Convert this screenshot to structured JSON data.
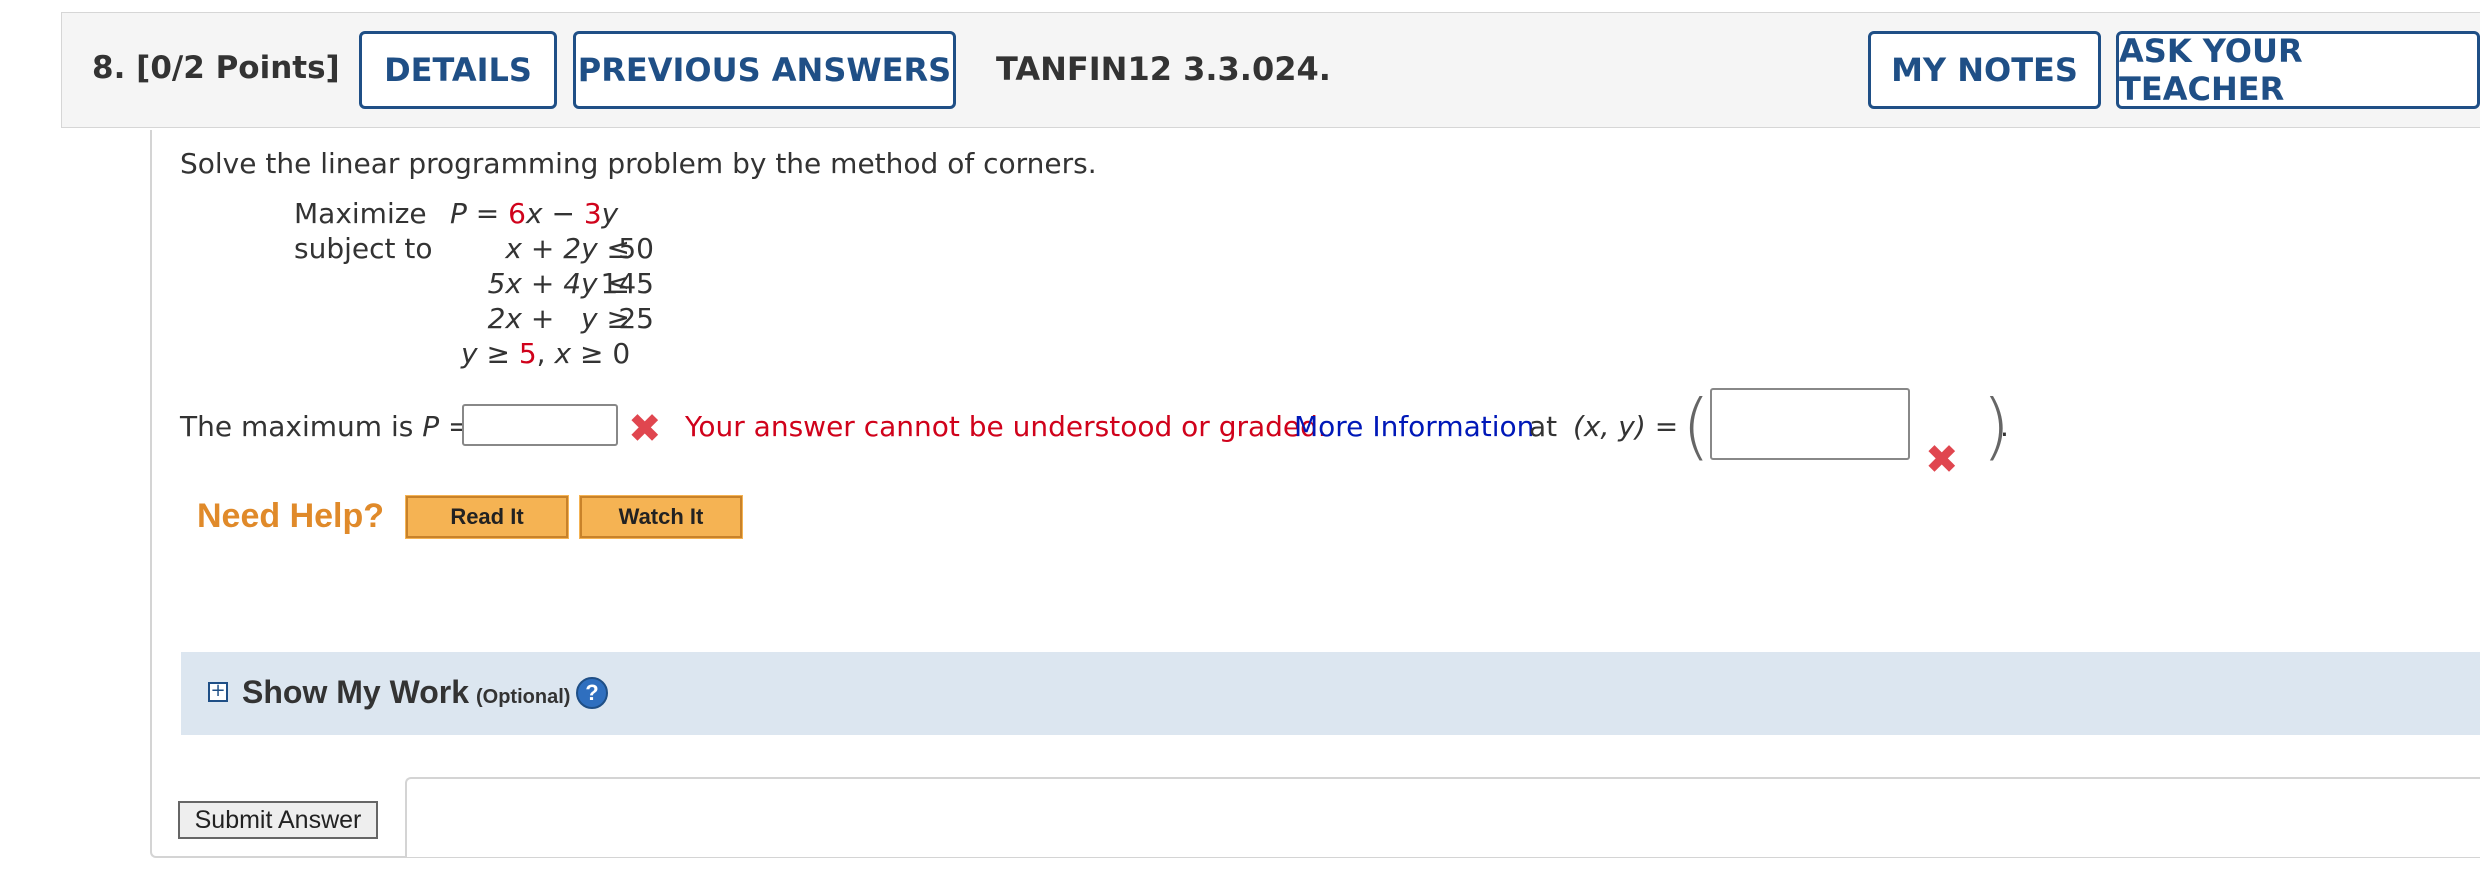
{
  "header": {
    "question_number": "8.",
    "points": "[0/2 Points]",
    "details_label": "DETAILS",
    "previous_answers_label": "PREVIOUS ANSWERS",
    "question_id": "TANFIN12 3.3.024.",
    "my_notes_label": "MY NOTES",
    "ask_teacher_label": "ASK YOUR TEACHER"
  },
  "problem": {
    "instruction": "Solve the linear programming problem by the method of corners.",
    "maximize_word": "Maximize",
    "subject_to_word": "subject to",
    "objective": {
      "var": "P",
      "eq": " = ",
      "c1": "6",
      "x": "x",
      "minus": " − ",
      "c2": "3",
      "y": "y"
    },
    "constraints": [
      {
        "lhs": "x + 2y ≤",
        "rhs": "50"
      },
      {
        "lhs": "5x + 4y ≤",
        "rhs": "145"
      },
      {
        "lhs": "2x +   y ≥",
        "rhs": "25"
      }
    ],
    "last_constraint": {
      "y": "y",
      "ge1": " ≥ ",
      "five": "5",
      "comma": ", ",
      "x": "x",
      "ge2": " ≥ 0"
    }
  },
  "answer": {
    "prefix": "The maximum is ",
    "p_var": "P",
    "eq": " =",
    "p_value": "",
    "error_text": "Your answer cannot be understood or graded.",
    "more_info": "More Information",
    "at_word": "at",
    "xy_label": "(x, y) =",
    "xy_value": "",
    "close_paren_period": "."
  },
  "help": {
    "need_help": "Need Help?",
    "read_it": "Read It",
    "watch_it": "Watch It"
  },
  "show_my_work": {
    "title": "Show My Work",
    "optional": "(Optional)",
    "help_icon_glyph": "?"
  },
  "submit_label": "Submit Answer",
  "colors": {
    "accent": "#1f4f86",
    "error": "#d0021b",
    "link": "#0018b8",
    "help_orange": "#e08a2a"
  }
}
